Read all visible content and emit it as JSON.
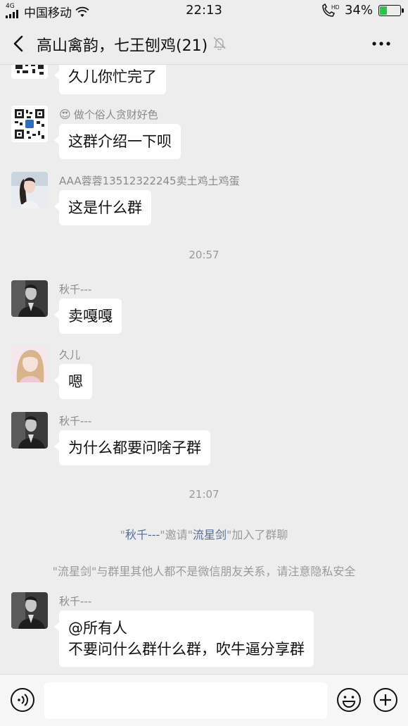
{
  "status_bar": {
    "signal": "4G",
    "carrier": "中国移动",
    "time": "22:13",
    "hd": "HD",
    "battery": "34%",
    "battery_level": 0.34
  },
  "nav": {
    "title": "高山禽韵，七王刨鸡(21)",
    "back_icon": "chevron-left-icon",
    "mute_icon": "bell-off-icon",
    "more_icon": "ellipsis-icon"
  },
  "messages": [
    {
      "type": "text",
      "sender": "",
      "lines": [
        "久儿你忙完了"
      ],
      "avatar": "qr-code"
    },
    {
      "type": "text",
      "sender": "做个俗人贪财好色",
      "emoji": "😍",
      "lines": [
        "这群介绍一下呗"
      ],
      "avatar": "qr-code"
    },
    {
      "type": "text",
      "sender": "AAA蓉蓉13512322245卖土鸡土鸡蛋",
      "lines": [
        "这是什么群"
      ],
      "avatar": "woman-photo"
    },
    {
      "type": "time",
      "text": "20:57"
    },
    {
      "type": "text",
      "sender": "秋千---",
      "lines": [
        "卖嘎嘎"
      ],
      "avatar": "man-photo"
    },
    {
      "type": "text",
      "sender": "久儿",
      "lines": [
        "嗯"
      ],
      "avatar": "girl-photo"
    },
    {
      "type": "text",
      "sender": "秋千---",
      "lines": [
        "为什么都要问啥子群"
      ],
      "avatar": "man-photo"
    },
    {
      "type": "time",
      "text": "21:07"
    },
    {
      "type": "system",
      "parts": [
        "\"",
        "秋千---",
        "\"邀请\"",
        "流星剑",
        "\"加入了群聊"
      ]
    },
    {
      "type": "system_plain",
      "text": "\"流星剑\"与群里其他人都不是微信朋友关系，请注意隐私安全"
    },
    {
      "type": "text",
      "sender": "秋千---",
      "lines": [
        "@所有人",
        "不要问什么群什么群，吹牛逼分享群"
      ],
      "avatar": "man-photo"
    }
  ],
  "input_bar": {
    "voice_icon": "voice-icon",
    "placeholder": "",
    "emoji_icon": "emoji-icon",
    "plus_icon": "plus-icon"
  },
  "colors": {
    "background": "#ededed",
    "bubble": "#ffffff",
    "link": "#576b95",
    "battery_fill": "#2ec24c"
  }
}
